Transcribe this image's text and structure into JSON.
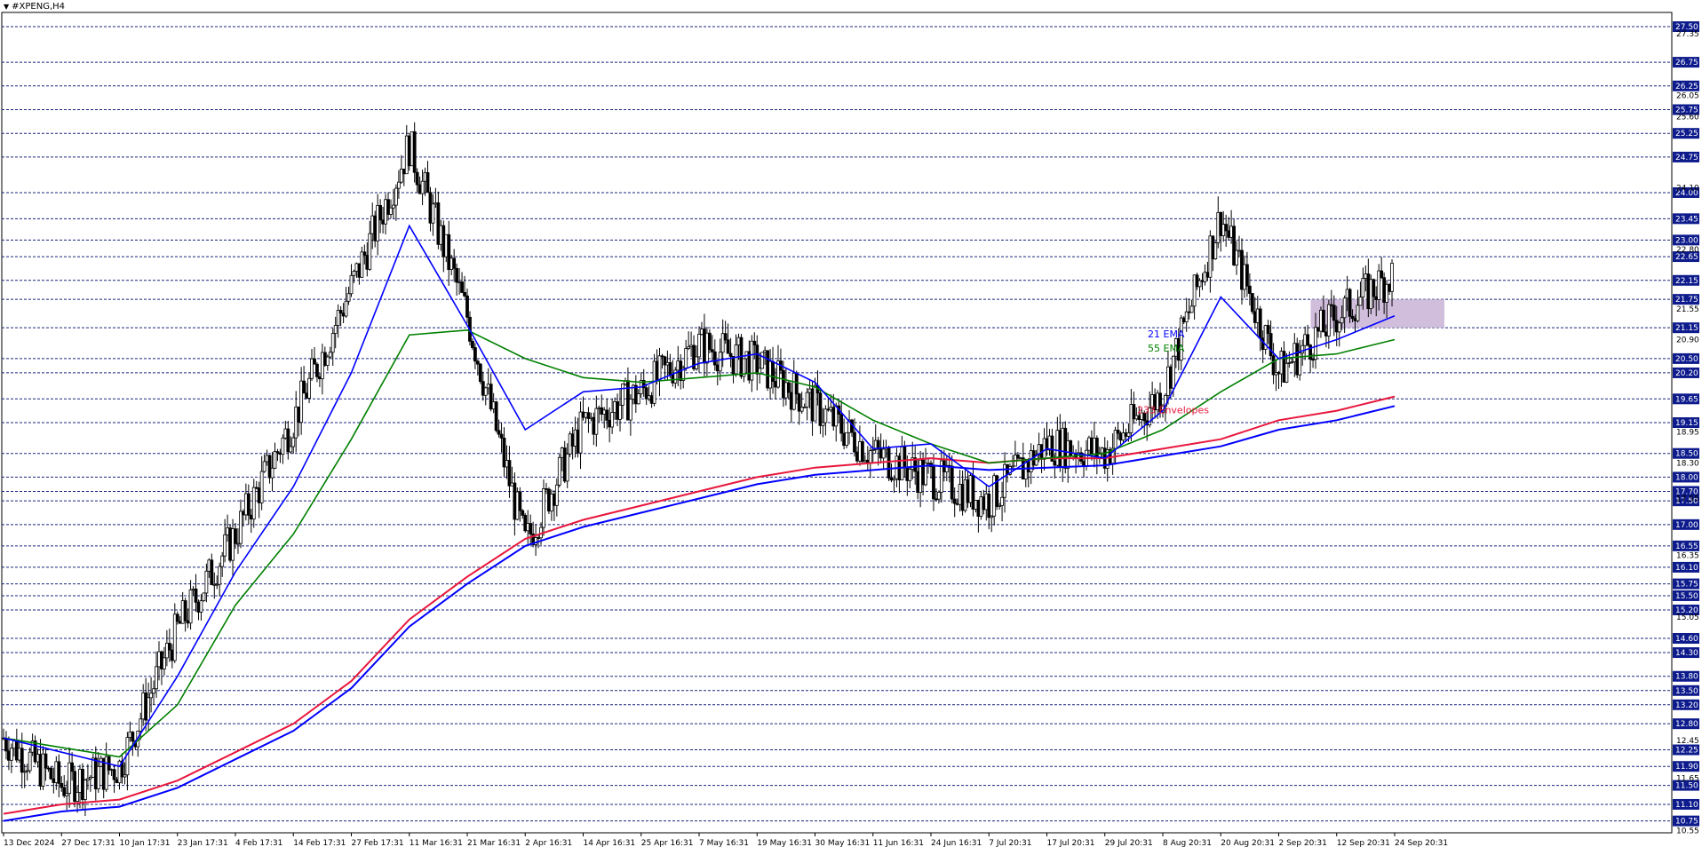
{
  "window": {
    "title": "#XPENG,H4",
    "dropdown_icon": "triangle-down-icon"
  },
  "colors": {
    "grid": "#1a237e",
    "price_bg": "#0d1b8c",
    "ema21": "#0000ff",
    "ema55": "#008000",
    "env_upper": "#e8173c",
    "env_lower": "#0000ff",
    "zone": "#c9b3d6",
    "candle": "#000000"
  },
  "chart_data": {
    "type": "candlestick",
    "symbol": "#XPENG",
    "timeframe": "H4",
    "ylim": [
      10.5,
      27.8
    ],
    "price_levels": [
      "27.50",
      "26.75",
      "26.25",
      "25.75",
      "25.25",
      "24.75",
      "24.00",
      "23.45",
      "23.00",
      "22.65",
      "22.15",
      "21.75",
      "21.15",
      "20.50",
      "20.20",
      "19.65",
      "19.15",
      "18.50",
      "18.00",
      "17.70",
      "17.50",
      "17.00",
      "16.55",
      "16.10",
      "15.75",
      "15.50",
      "15.20",
      "14.60",
      "14.30",
      "13.80",
      "13.50",
      "13.20",
      "12.80",
      "12.25",
      "11.90",
      "11.50",
      "11.10",
      "10.75"
    ],
    "minor_ticks": [
      "27.35",
      "26.05",
      "25.60",
      "24.10",
      "22.80",
      "21.55",
      "20.90",
      "18.95",
      "18.30",
      "17.55",
      "16.35",
      "15.05",
      "12.45",
      "11.65",
      "10.55"
    ],
    "x_labels": [
      "13 Dec 2024",
      "27 Dec 17:31",
      "10 Jan 17:31",
      "23 Jan 17:31",
      "4 Feb 17:31",
      "14 Feb 17:31",
      "27 Feb 17:31",
      "11 Mar 16:31",
      "21 Mar 16:31",
      "2 Apr 16:31",
      "14 Apr 16:31",
      "25 Apr 16:31",
      "7 May 16:31",
      "19 May 16:31",
      "30 May 16:31",
      "11 Jun 16:31",
      "24 Jun 16:31",
      "7 Jul 20:31",
      "17 Jul 20:31",
      "29 Jul 20:31",
      "8 Aug 20:31",
      "20 Aug 20:31",
      "2 Sep 20:31",
      "12 Sep 20:31",
      "24 Sep 20:31"
    ],
    "price_path": [
      [
        "13 Dec 2024",
        12.5
      ],
      [
        "27 Dec 17:31",
        11.5
      ],
      [
        "10 Jan 17:31",
        11.9
      ],
      [
        "23 Jan 17:31",
        14.8
      ],
      [
        "4 Feb 17:31",
        16.8
      ],
      [
        "14 Feb 17:31",
        19.2
      ],
      [
        "27 Feb 17:31",
        22.0
      ],
      [
        "11 Mar 16:31",
        25.0
      ],
      [
        "21 Mar 16:31",
        21.4
      ],
      [
        "2 Apr 16:31",
        16.6
      ],
      [
        "14 Apr 16:31",
        19.1
      ],
      [
        "25 Apr 16:31",
        19.8
      ],
      [
        "7 May 16:31",
        20.8
      ],
      [
        "19 May 16:31",
        20.4
      ],
      [
        "30 May 16:31",
        19.5
      ],
      [
        "11 Jun 16:31",
        18.5
      ],
      [
        "24 Jun 16:31",
        18.0
      ],
      [
        "7 Jul 20:31",
        17.5
      ],
      [
        "17 Jul 20:31",
        18.7
      ],
      [
        "29 Jul 20:31",
        18.5
      ],
      [
        "8 Aug 20:31",
        19.8
      ],
      [
        "20 Aug 20:31",
        23.5
      ],
      [
        "2 Sep 20:31",
        20.2
      ],
      [
        "12 Sep 20:31",
        21.4
      ],
      [
        "24 Sep 20:31",
        22.3
      ]
    ],
    "ema21": [
      12.5,
      12.2,
      11.9,
      13.8,
      16.0,
      17.8,
      20.2,
      23.3,
      21.2,
      19.0,
      19.8,
      19.9,
      20.4,
      20.6,
      20.0,
      18.6,
      18.7,
      17.8,
      18.6,
      18.4,
      19.4,
      21.8,
      20.5,
      20.9,
      21.4
    ],
    "ema55": [
      12.5,
      12.3,
      12.1,
      13.2,
      15.3,
      16.8,
      18.8,
      21.0,
      21.1,
      20.5,
      20.1,
      20.0,
      20.1,
      20.2,
      19.9,
      19.2,
      18.7,
      18.3,
      18.4,
      18.5,
      19.0,
      19.8,
      20.5,
      20.6,
      20.9
    ],
    "envelope_upper": [
      10.9,
      11.1,
      11.2,
      11.6,
      12.2,
      12.8,
      13.7,
      15.0,
      15.9,
      16.7,
      17.1,
      17.4,
      17.7,
      18.0,
      18.2,
      18.3,
      18.4,
      18.3,
      18.4,
      18.4,
      18.6,
      18.8,
      19.2,
      19.4,
      19.7
    ],
    "envelope_lower": [
      10.75,
      10.95,
      11.05,
      11.45,
      12.05,
      12.65,
      13.55,
      14.85,
      15.75,
      16.55,
      16.95,
      17.25,
      17.55,
      17.85,
      18.05,
      18.15,
      18.25,
      18.15,
      18.2,
      18.25,
      18.45,
      18.65,
      19.0,
      19.2,
      19.5
    ],
    "zone": {
      "from_label": "2 Sep 20:31",
      "to_label": "24 Sep 20:31",
      "low": 21.15,
      "high": 21.75
    },
    "legend": {
      "ema21": "21 EMA",
      "ema55": "55 EMA",
      "envelopes": "233 Envelopes"
    },
    "highlighted_levels": [
      "27.50",
      "26.75",
      "26.25",
      "25.75",
      "25.25",
      "24.75",
      "24.00",
      "23.45",
      "23.00",
      "22.65",
      "22.15",
      "21.75",
      "21.15",
      "20.50",
      "20.20",
      "19.65",
      "19.15",
      "18.50",
      "18.00",
      "17.70",
      "17.50",
      "17.00",
      "16.55",
      "16.10",
      "15.75",
      "15.50",
      "15.20",
      "14.60",
      "14.30",
      "13.80",
      "13.50",
      "13.20",
      "12.80",
      "12.25",
      "11.90",
      "11.50",
      "11.10",
      "10.75"
    ],
    "grid": true
  }
}
